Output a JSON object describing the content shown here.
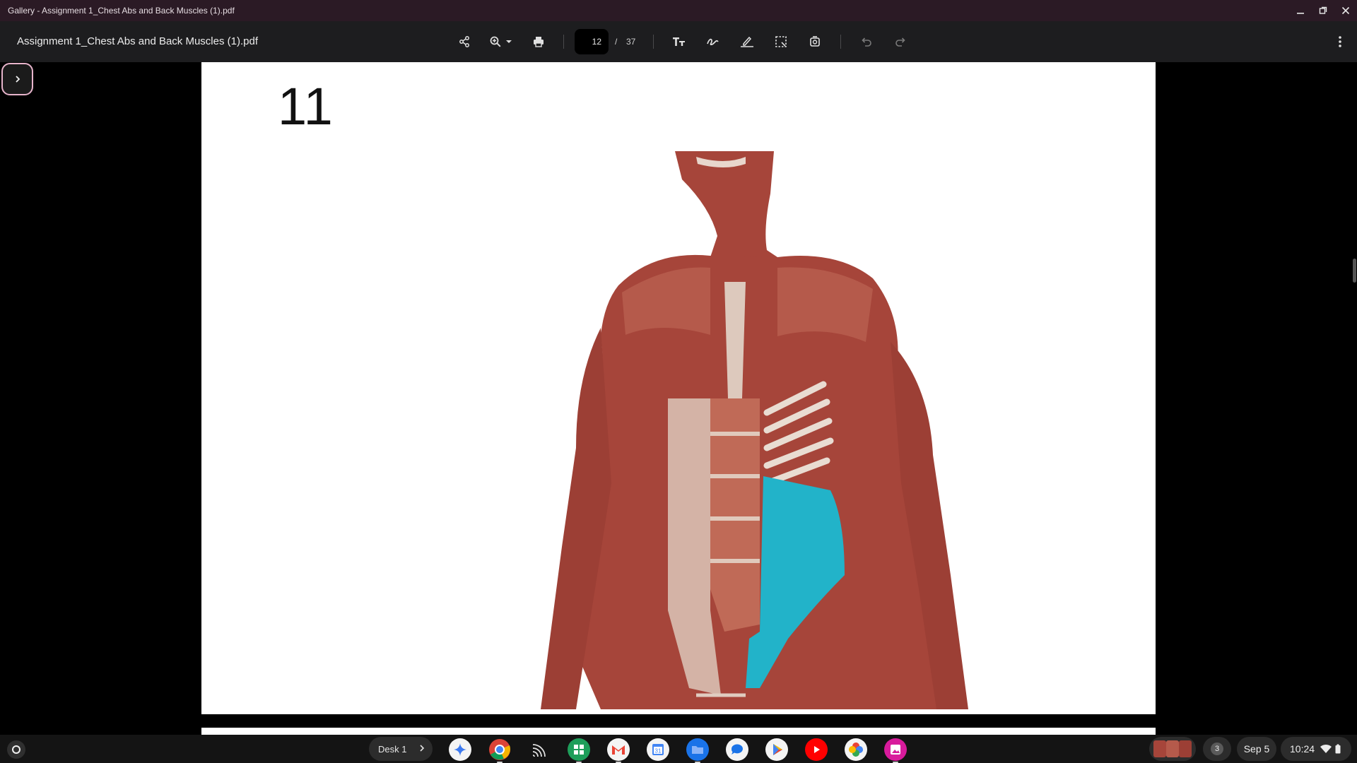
{
  "window": {
    "title": "Gallery - Assignment 1_Chest Abs and Back Muscles (1).pdf",
    "controls": [
      "minimize-icon",
      "restore-icon",
      "close-icon"
    ]
  },
  "toolbar": {
    "doc_title": "Assignment 1_Chest Abs and Back Muscles (1).pdf",
    "current_page": "12",
    "page_separator": "/",
    "total_pages": "37",
    "icons": [
      "share-icon",
      "zoom-in-icon",
      "chevron-down-icon",
      "print-icon",
      "text-icon",
      "draw-icon",
      "sign-icon",
      "select-area-icon",
      "rotate-icon",
      "undo-icon",
      "redo-icon",
      "more-vert-icon"
    ]
  },
  "document": {
    "page_number_label": "11",
    "figure": "anatomical-torso-image"
  },
  "shelf": {
    "desk_label": "Desk 1",
    "apps": [
      "gemini-icon",
      "chrome-icon",
      "cast-icon",
      "sheets-icon",
      "gmail-icon",
      "calendar-icon",
      "files-icon",
      "messages-icon",
      "play-store-icon",
      "youtube-icon",
      "photos-icon",
      "gallery-icon"
    ],
    "notification_count": "3",
    "date": "Sep 5",
    "time": "10:24"
  },
  "colors": {
    "titlebar": "#2b1a25",
    "toolbar": "#1d1d1f",
    "accent_pink": "#e7b4cb",
    "muscle_highlight": "#22b3c9",
    "muscle": "#a6453a"
  }
}
